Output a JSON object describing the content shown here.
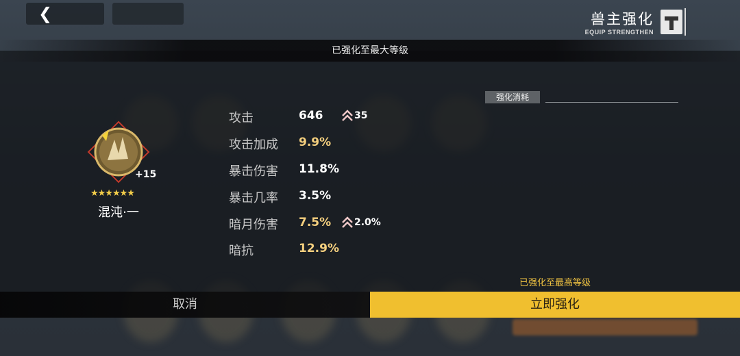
{
  "header": {
    "back_icon": "chevron-left-icon",
    "title": "兽主强化",
    "subtitle": "EQUIP STRENGTHEN",
    "hammer_icon": "hammer-icon"
  },
  "banner": {
    "text": "已强化至最大等级"
  },
  "item": {
    "icon": "beast-emblem-icon",
    "level": "+15",
    "stars": "★★★★★★",
    "name": "混沌·一"
  },
  "stats": [
    {
      "label": "攻击",
      "value": "646",
      "color": "#ffffff",
      "bonus": "35"
    },
    {
      "label": "攻击加成",
      "value": "9.9%",
      "color": "#f4cf7e",
      "bonus": ""
    },
    {
      "label": "暴击伤害",
      "value": "11.8%",
      "color": "#ffffff",
      "bonus": ""
    },
    {
      "label": "暴击几率",
      "value": "3.5%",
      "color": "#ffffff",
      "bonus": ""
    },
    {
      "label": "暗月伤害",
      "value": "7.5%",
      "color": "#f4cf7e",
      "bonus": "2.0%"
    },
    {
      "label": "暗抗",
      "value": "12.9%",
      "color": "#f4cf7e",
      "bonus": ""
    }
  ],
  "cost": {
    "label": "强化消耗"
  },
  "footer": {
    "max_note": "已强化至最高等级",
    "cancel_label": "取消",
    "confirm_label": "立即强化"
  },
  "colors": {
    "accent": "#f0bf2f",
    "gold_text": "#f4cf7e",
    "note": "#f0c342"
  }
}
